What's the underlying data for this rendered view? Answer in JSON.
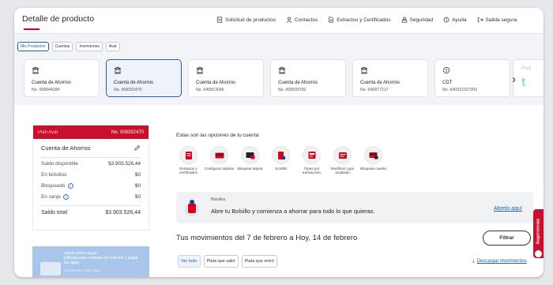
{
  "header": {
    "title": "Detalle de producto",
    "nav": [
      {
        "label": "Solicitud de productos",
        "icon": "document-icon"
      },
      {
        "label": "Contactos",
        "icon": "person-icon"
      },
      {
        "label": "Extractos y Certificados",
        "icon": "file-icon"
      },
      {
        "label": "Seguridad",
        "icon": "lock-person-icon"
      },
      {
        "label": "Ayuda",
        "icon": "help-icon"
      },
      {
        "label": "Salida segura",
        "icon": "logout-icon"
      }
    ]
  },
  "product_tabs": [
    "Mis Productos",
    "Cuentas",
    "Inversiones",
    "Aval"
  ],
  "accounts": [
    {
      "name": "Cuenta de Ahorros",
      "number": "No. 008944284"
    },
    {
      "name": "Cuenta de Ahorros",
      "number": "No. 008332470"
    },
    {
      "name": "Cuenta de Ahorros",
      "number": "No. 640813096"
    },
    {
      "name": "Cuenta de Ahorros",
      "number": "No. 008939782"
    },
    {
      "name": "Cuenta de Ahorros",
      "number": "No. 640877217"
    },
    {
      "name": "CDT",
      "number": "No. 640331027003"
    }
  ],
  "partial_card": {
    "label": "Punt",
    "logo": "t"
  },
  "account_panel": {
    "plan": "Plan Aval",
    "number": "No. 008332470",
    "name": "Cuenta de Ahorros",
    "balances": [
      {
        "label": "Saldo disponible",
        "value": "$3.903.526,44"
      },
      {
        "label": "En bolsillos",
        "value": "$0"
      },
      {
        "label": "Bloqueado",
        "value": "$0"
      },
      {
        "label": "En canje",
        "value": "$0"
      }
    ],
    "total_label": "Saldo total",
    "total_value": "$3.903.526,44"
  },
  "promo": {
    "tag": "Tarjeta Débito Digital",
    "text": "Utilízala para comprar por internet y pagar tus apps",
    "cta": "Actívala sin costo aquí"
  },
  "options_title": "Estas son las opciones de tu cuenta:",
  "options": [
    {
      "label": "Extractos y certificados",
      "icon": "document-icon"
    },
    {
      "label": "Configurar tarjetas",
      "icon": "card-settings-icon"
    },
    {
      "label": "Bloquear tarjeta",
      "icon": "card-lock-icon"
    },
    {
      "label": "4x1000",
      "icon": "tax-document-icon"
    },
    {
      "label": "Topes por transacción",
      "icon": "limits-icon"
    },
    {
      "label": "Modificar cupo ampliado",
      "icon": "edit-limit-icon"
    },
    {
      "label": "Bloquear cuenta",
      "icon": "account-lock-icon"
    }
  ],
  "bolsillo": {
    "title": "Bolsillos",
    "message": "Abre tu Bolsillo y comienza a ahorrar para todo lo que quieras.",
    "link": "Abrelo aquí"
  },
  "movements": {
    "title": "Tus movimientos del 7 de febrero a Hoy, 14 de febrero",
    "filter_button": "Filtrar",
    "filters": [
      "Ver todo",
      "Plata que salió",
      "Plata que entró"
    ],
    "download": "Descargar movimientos"
  },
  "sugerencias": "Sugerencias",
  "colors": {
    "brand_red": "#c8102e",
    "link_blue": "#1f5fae"
  }
}
